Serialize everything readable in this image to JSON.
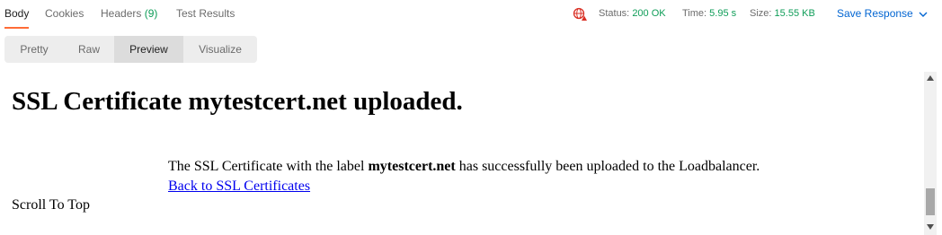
{
  "response_tabs": {
    "body": "Body",
    "cookies": "Cookies",
    "headers_label": "Headers",
    "headers_count": "(9)",
    "test_results": "Test Results"
  },
  "status_bar": {
    "status_label": "Status:",
    "status_value": "200 OK",
    "time_label": "Time:",
    "time_value": "5.95 s",
    "size_label": "Size:",
    "size_value": "15.55 KB",
    "save_response": "Save Response"
  },
  "view_modes": {
    "pretty": "Pretty",
    "raw": "Raw",
    "preview": "Preview",
    "visualize": "Visualize",
    "selected": "Preview"
  },
  "preview": {
    "heading": "SSL Certificate mytestcert.net uploaded.",
    "message_prefix": "The SSL Certificate with the label ",
    "message_label": "mytestcert.net",
    "message_suffix": " has successfully been uploaded to the Loadbalancer.",
    "back_link": "Back to SSL Certificates",
    "scroll_to_top": "Scroll To Top"
  },
  "colors": {
    "accent_tab_underline": "#ff6c37",
    "status_ok": "#0f9d58",
    "link_blue": "#0265d2",
    "globe_icon": "#d93025"
  },
  "icons": {
    "network": "globe-warning-icon",
    "save_chevron": "chevron-down-icon"
  }
}
